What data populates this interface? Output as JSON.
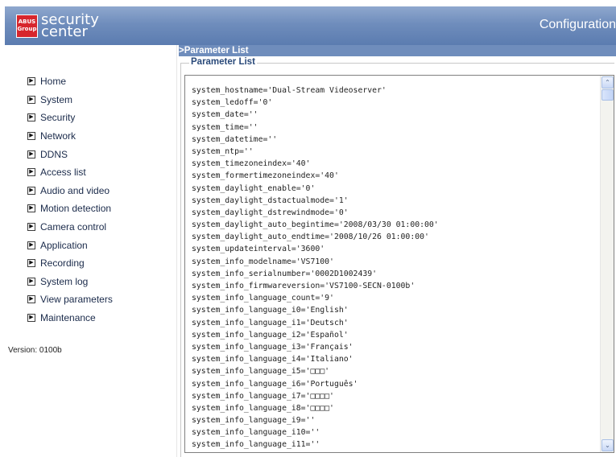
{
  "header": {
    "logo_badge_line1": "ABUS",
    "logo_badge_line2": "Group",
    "logo_line1": "security",
    "logo_line2": "center",
    "config_title": "Configuration"
  },
  "sidebar": {
    "items": [
      {
        "label": "Home"
      },
      {
        "label": "System"
      },
      {
        "label": "Security"
      },
      {
        "label": "Network"
      },
      {
        "label": "DDNS"
      },
      {
        "label": "Access list"
      },
      {
        "label": "Audio and video"
      },
      {
        "label": "Motion detection"
      },
      {
        "label": "Camera control"
      },
      {
        "label": "Application"
      },
      {
        "label": "Recording"
      },
      {
        "label": "System log"
      },
      {
        "label": "View parameters"
      },
      {
        "label": "Maintenance"
      }
    ],
    "version": "Version: 0100b"
  },
  "main": {
    "section_title": ">Parameter List",
    "legend": "Parameter List",
    "lines": [
      "system_hostname='Dual-Stream Videoserver'",
      "system_ledoff='0'",
      "system_date=''",
      "system_time=''",
      "system_datetime=''",
      "system_ntp=''",
      "system_timezoneindex='40'",
      "system_formertimezoneindex='40'",
      "system_daylight_enable='0'",
      "system_daylight_dstactualmode='1'",
      "system_daylight_dstrewindmode='0'",
      "system_daylight_auto_begintime='2008/03/30 01:00:00'",
      "system_daylight_auto_endtime='2008/10/26 01:00:00'",
      "system_updateinterval='3600'",
      "system_info_modelname='VS7100'",
      "system_info_serialnumber='0002D1002439'",
      "system_info_firmwareversion='VS7100-SECN-0100b'",
      "system_info_language_count='9'",
      "system_info_language_i0='English'",
      "system_info_language_i1='Deutsch'",
      "system_info_language_i2='Español'",
      "system_info_language_i3='Français'",
      "system_info_language_i4='Italiano'",
      "system_info_language_i5='□□□'",
      "system_info_language_i6='Português'",
      "system_info_language_i7='□□□□'",
      "system_info_language_i8='□□□□'",
      "system_info_language_i9=''",
      "system_info_language_i10=''",
      "system_info_language_i11=''"
    ]
  }
}
